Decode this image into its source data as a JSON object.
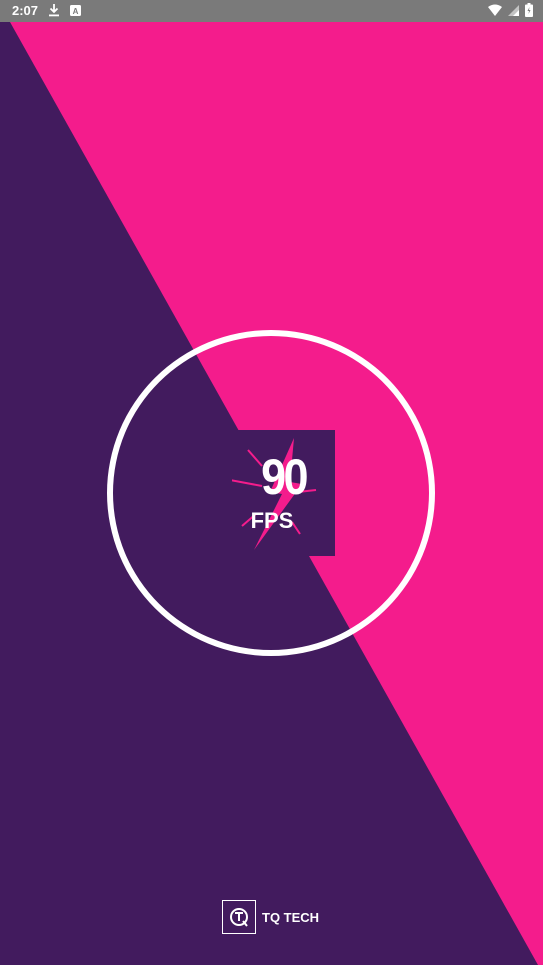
{
  "status_bar": {
    "time": "2:07",
    "left_icons": [
      "download-icon",
      "a-badge-icon"
    ],
    "right_icons": [
      "wifi-icon",
      "signal-icon",
      "battery-icon"
    ]
  },
  "colors": {
    "purple": "#421b5e",
    "pink": "#f41c8c",
    "white": "#ffffff",
    "status_bar": "#7a7a7a"
  },
  "logo": {
    "number": "90",
    "unit": "FPS",
    "icon": "lightning-bolt-icon"
  },
  "brand": {
    "name": "TQ TECH",
    "icon": "tq-logo-icon"
  }
}
